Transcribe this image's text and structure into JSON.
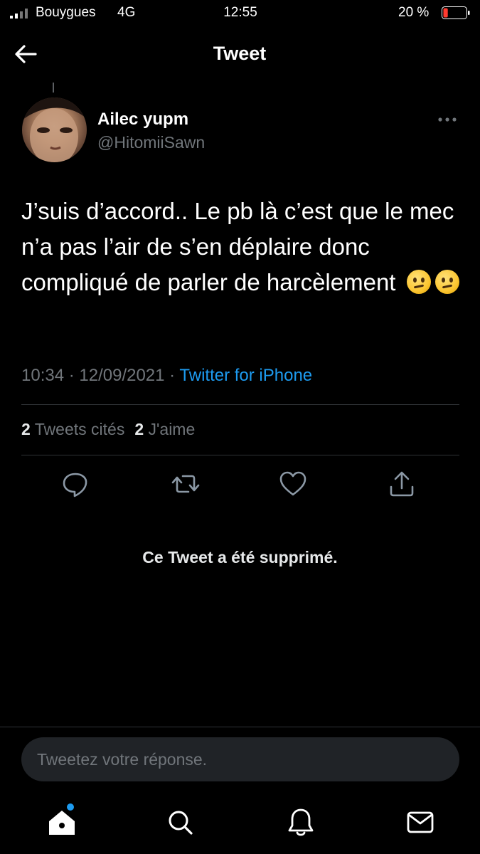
{
  "status_bar": {
    "carrier": "Bouygues",
    "network": "4G",
    "time": "12:55",
    "battery": "20 %",
    "battery_level": 0.2
  },
  "header": {
    "title": "Tweet"
  },
  "tweet": {
    "author_name": "Ailec yupm",
    "author_handle": "@HitomiiSawn",
    "text": "J’suis d’accord.. Le pb là c’est que le mec n’a pas l’air de s’en déplaire donc compliqué de parler de harcèlement",
    "emoji": [
      "confused-face",
      "confused-face"
    ],
    "timestamp": "10:34 · 12/09/2021 ·",
    "source": "Twitter for iPhone",
    "quote_count": "2",
    "quote_label": "Tweets cités",
    "like_count": "2",
    "like_label": "J'aime"
  },
  "actions": {
    "icons": [
      "reply-icon",
      "retweet-icon",
      "like-icon",
      "share-icon"
    ]
  },
  "deleted_notice": "Ce Tweet a été supprimé.",
  "reply_box": {
    "placeholder": "Tweetez votre réponse."
  },
  "tab_bar": {
    "icons": [
      "home-icon",
      "search-icon",
      "notifications-icon",
      "messages-icon"
    ]
  },
  "colors": {
    "background": "#000000",
    "accent": "#1d9bf0",
    "muted": "#71767b",
    "battery_low": "#ff3b30"
  }
}
